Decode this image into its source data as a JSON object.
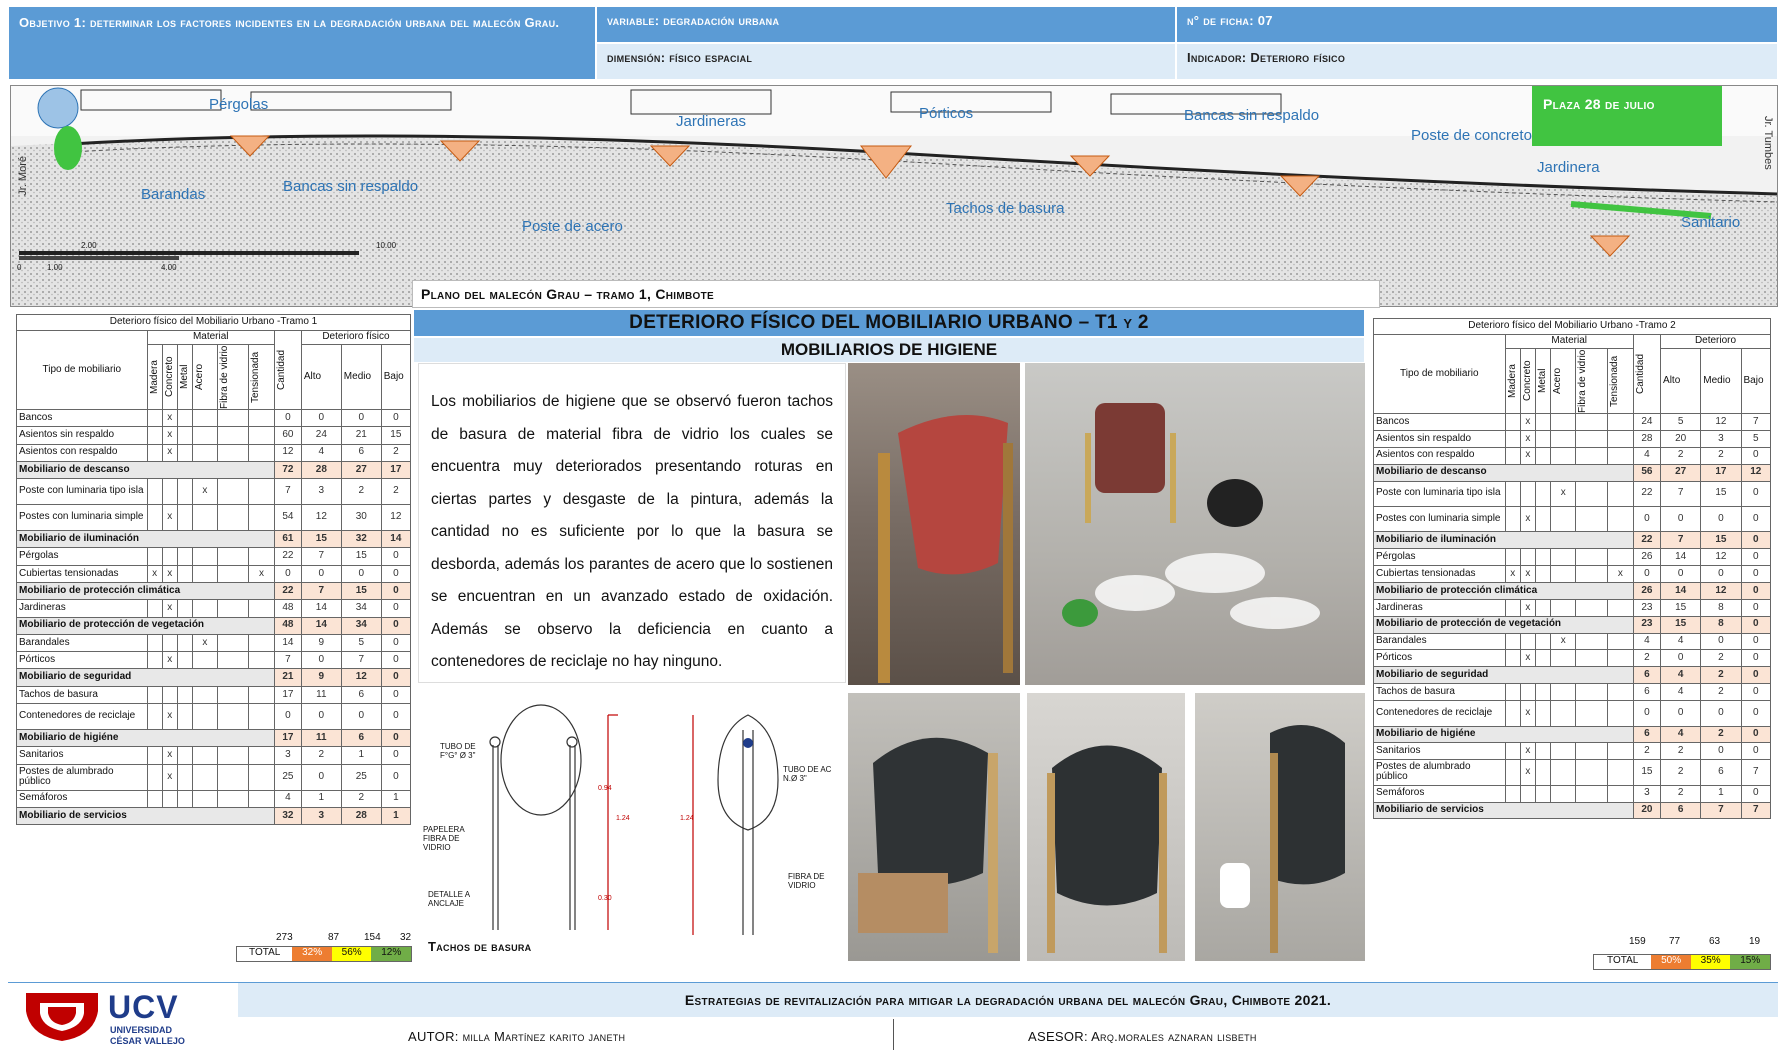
{
  "header": {
    "objetivo": "Objetivo 1: determinar los factores incidentes en la degradación urbana del malecón Grau.",
    "variable": "variable: degradación urbana",
    "ficha": "n° de ficha: 07",
    "dimension": "dimensión: físico espacial",
    "indicador": "Indicador: Deterioro físico"
  },
  "map": {
    "plaza": "Plaza 28 de julio",
    "street_left": "Jr. Moré",
    "street_right": "Jr. Tumbes",
    "labels": [
      "Pérgolas",
      "Barandas",
      "Bancas sin respaldo",
      "Jardineras",
      "Pórticos",
      "Poste de acero",
      "Tachos de basura",
      "Bancas sin respaldo",
      "Poste de concreto",
      "Jardinera",
      "Sanitario"
    ],
    "scale": [
      "2.00",
      "10.00",
      "0",
      "1.00",
      "4.00"
    ]
  },
  "plan_title": "Plano del malecón Grau – tramo 1, Chimbote",
  "main_title": "DETERIORO FÍSICO DEL MOBILIARIO URBANO – T1 y 2",
  "sub_title": "MOBILIARIOS DE HIGIENE",
  "paragraph": "Los mobiliarios de higiene que se observó fueron tachos de basura de material fibra de vidrio los cuales se encuentra muy deteriorados presentando roturas en ciertas partes y desgaste de la pintura, además la cantidad no es suficiente por lo que la basura se desborda, además los parantes de acero que lo sostienen se encuentran en un avanzado estado de oxidación. Además se observo la deficiencia en cuanto a contenedores de reciclaje no hay ninguno.",
  "drawing": {
    "caption": "Tachos de basura",
    "notes": [
      "TUBO DE F°G° Ø 3\"",
      "PAPELERA FIBRA DE VIDRIO",
      "DETALLE A ANCLAJE",
      "TUBO DE AC N.Ø 3\"",
      "FIBRA DE VIDRIO"
    ],
    "dims": [
      "0.94",
      "1.24",
      "1.24",
      "0.30"
    ]
  },
  "table1": {
    "title": "Deterioro físico del Mobiliario Urbano -Tramo 1",
    "h_tipo": "Tipo de mobiliario",
    "h_material": "Material",
    "h_det": "Deterioro físico",
    "mat": [
      "Madera",
      "Concreto",
      "Metal",
      "Acero",
      "Fibra de vidrio",
      "Tensionada"
    ],
    "h_cant": "Cantidad",
    "lv": [
      "Alto",
      "Medio",
      "Bajo"
    ],
    "rows": [
      {
        "n": "Bancos",
        "m": [
          "",
          "x",
          "",
          "",
          "",
          ""
        ],
        "v": [
          "0",
          "0",
          "0",
          "0"
        ]
      },
      {
        "n": "Asientos sin respaldo",
        "m": [
          "",
          "x",
          "",
          "",
          "",
          ""
        ],
        "v": [
          "60",
          "24",
          "21",
          "15"
        ]
      },
      {
        "n": "Asientos con respaldo",
        "m": [
          "",
          "x",
          "",
          "",
          "",
          ""
        ],
        "v": [
          "12",
          "4",
          "6",
          "2"
        ]
      },
      {
        "n": "Mobiliario de descanso",
        "s": 1,
        "v": [
          "72",
          "28",
          "27",
          "17"
        ]
      },
      {
        "n": "Poste con luminaria tipo isla",
        "m": [
          "",
          "",
          "",
          "x",
          "",
          ""
        ],
        "v": [
          "7",
          "3",
          "2",
          "2"
        ]
      },
      {
        "n": "Postes con luminaria simple",
        "m": [
          "",
          "x",
          "",
          "",
          "",
          ""
        ],
        "v": [
          "54",
          "12",
          "30",
          "12"
        ]
      },
      {
        "n": "Mobiliario de iluminación",
        "s": 1,
        "v": [
          "61",
          "15",
          "32",
          "14"
        ]
      },
      {
        "n": "Pérgolas",
        "m": [
          "",
          "",
          "",
          "",
          "",
          ""
        ],
        "v": [
          "22",
          "7",
          "15",
          "0"
        ]
      },
      {
        "n": "Cubiertas tensionadas",
        "m": [
          "x",
          "x",
          "",
          "",
          "",
          "x"
        ],
        "v": [
          "0",
          "0",
          "0",
          "0"
        ]
      },
      {
        "n": "Mobiliario de protección climática",
        "s": 1,
        "v": [
          "22",
          "7",
          "15",
          "0"
        ]
      },
      {
        "n": "Jardineras",
        "m": [
          "",
          "x",
          "",
          "",
          "",
          ""
        ],
        "v": [
          "48",
          "14",
          "34",
          "0"
        ]
      },
      {
        "n": "Mobiliario de protección de vegetación",
        "s": 1,
        "v": [
          "48",
          "14",
          "34",
          "0"
        ]
      },
      {
        "n": "Barandales",
        "m": [
          "",
          "",
          "",
          "x",
          "",
          ""
        ],
        "v": [
          "14",
          "9",
          "5",
          "0"
        ]
      },
      {
        "n": "Pórticos",
        "m": [
          "",
          "x",
          "",
          "",
          "",
          ""
        ],
        "v": [
          "7",
          "0",
          "7",
          "0"
        ]
      },
      {
        "n": "Mobiliario de seguridad",
        "s": 1,
        "v": [
          "21",
          "9",
          "12",
          "0"
        ]
      },
      {
        "n": "Tachos de basura",
        "m": [
          "",
          "",
          "",
          "",
          "",
          ""
        ],
        "v": [
          "17",
          "11",
          "6",
          "0"
        ]
      },
      {
        "n": "Contenedores de reciclaje",
        "m": [
          "",
          "x",
          "",
          "",
          "",
          ""
        ],
        "v": [
          "0",
          "0",
          "0",
          "0"
        ]
      },
      {
        "n": "Mobiliario de higiéne",
        "s": 1,
        "v": [
          "17",
          "11",
          "6",
          "0"
        ]
      },
      {
        "n": "Sanitarios",
        "m": [
          "",
          "x",
          "",
          "",
          "",
          ""
        ],
        "v": [
          "3",
          "2",
          "1",
          "0"
        ]
      },
      {
        "n": "Postes de alumbrado público",
        "m": [
          "",
          "x",
          "",
          "",
          "",
          ""
        ],
        "v": [
          "25",
          "0",
          "25",
          "0"
        ]
      },
      {
        "n": "Semáforos",
        "m": [
          "",
          "",
          "",
          "",
          "",
          ""
        ],
        "v": [
          "4",
          "1",
          "2",
          "1"
        ]
      },
      {
        "n": "Mobiliario de servicios",
        "s": 1,
        "v": [
          "32",
          "3",
          "28",
          "1"
        ]
      }
    ],
    "tot_label": "TOTAL",
    "totals": [
      "273",
      "87",
      "154",
      "32"
    ],
    "pct": [
      "32%",
      "56%",
      "12%"
    ]
  },
  "table2": {
    "title": "Deterioro físico del Mobiliario Urbano -Tramo 2",
    "h_tipo": "Tipo de mobiliario",
    "h_material": "Material",
    "h_det": "Deterioro",
    "mat": [
      "Madera",
      "Concreto",
      "Metal",
      "Acero",
      "Fibra de vidrio",
      "Tensionada"
    ],
    "h_cant": "Cantidad",
    "lv": [
      "Alto",
      "Medio",
      "Bajo"
    ],
    "rows": [
      {
        "n": "Bancos",
        "m": [
          "",
          "x",
          "",
          "",
          "",
          ""
        ],
        "v": [
          "24",
          "5",
          "12",
          "7"
        ]
      },
      {
        "n": "Asientos sin respaldo",
        "m": [
          "",
          "x",
          "",
          "",
          "",
          ""
        ],
        "v": [
          "28",
          "20",
          "3",
          "5"
        ]
      },
      {
        "n": "Asientos con respaldo",
        "m": [
          "",
          "x",
          "",
          "",
          "",
          ""
        ],
        "v": [
          "4",
          "2",
          "2",
          "0"
        ]
      },
      {
        "n": "Mobiliario de descanso",
        "s": 1,
        "v": [
          "56",
          "27",
          "17",
          "12"
        ]
      },
      {
        "n": "Poste con luminaria tipo isla",
        "m": [
          "",
          "",
          "",
          "x",
          "",
          ""
        ],
        "v": [
          "22",
          "7",
          "15",
          "0"
        ]
      },
      {
        "n": "Postes con luminaria simple",
        "m": [
          "",
          "x",
          "",
          "",
          "",
          ""
        ],
        "v": [
          "0",
          "0",
          "0",
          "0"
        ]
      },
      {
        "n": "Mobiliario de iluminación",
        "s": 1,
        "v": [
          "22",
          "7",
          "15",
          "0"
        ]
      },
      {
        "n": "Pérgolas",
        "m": [
          "",
          "",
          "",
          "",
          "",
          ""
        ],
        "v": [
          "26",
          "14",
          "12",
          "0"
        ]
      },
      {
        "n": "Cubiertas tensionadas",
        "m": [
          "x",
          "x",
          "",
          "",
          "",
          "x"
        ],
        "v": [
          "0",
          "0",
          "0",
          "0"
        ]
      },
      {
        "n": "Mobiliario de protección climática",
        "s": 1,
        "v": [
          "26",
          "14",
          "12",
          "0"
        ]
      },
      {
        "n": "Jardineras",
        "m": [
          "",
          "x",
          "",
          "",
          "",
          ""
        ],
        "v": [
          "23",
          "15",
          "8",
          "0"
        ]
      },
      {
        "n": "Mobiliario de protección de vegetación",
        "s": 1,
        "v": [
          "23",
          "15",
          "8",
          "0"
        ]
      },
      {
        "n": "Barandales",
        "m": [
          "",
          "",
          "",
          "x",
          "",
          ""
        ],
        "v": [
          "4",
          "4",
          "0",
          "0"
        ]
      },
      {
        "n": "Pórticos",
        "m": [
          "",
          "x",
          "",
          "",
          "",
          ""
        ],
        "v": [
          "2",
          "0",
          "2",
          "0"
        ]
      },
      {
        "n": "Mobiliario de seguridad",
        "s": 1,
        "v": [
          "6",
          "4",
          "2",
          "0"
        ]
      },
      {
        "n": "Tachos de basura",
        "m": [
          "",
          "",
          "",
          "",
          "",
          ""
        ],
        "v": [
          "6",
          "4",
          "2",
          "0"
        ]
      },
      {
        "n": "Contenedores de reciclaje",
        "m": [
          "",
          "x",
          "",
          "",
          "",
          ""
        ],
        "v": [
          "0",
          "0",
          "0",
          "0"
        ]
      },
      {
        "n": "Mobiliario de higiéne",
        "s": 1,
        "v": [
          "6",
          "4",
          "2",
          "0"
        ]
      },
      {
        "n": "Sanitarios",
        "m": [
          "",
          "x",
          "",
          "",
          "",
          ""
        ],
        "v": [
          "2",
          "2",
          "0",
          "0"
        ]
      },
      {
        "n": "Postes de alumbrado público",
        "m": [
          "",
          "x",
          "",
          "",
          "",
          ""
        ],
        "v": [
          "15",
          "2",
          "6",
          "7"
        ]
      },
      {
        "n": "Semáforos",
        "m": [
          "",
          "",
          "",
          "",
          "",
          ""
        ],
        "v": [
          "3",
          "2",
          "1",
          "0"
        ]
      },
      {
        "n": "Mobiliario de servicios",
        "s": 1,
        "v": [
          "20",
          "6",
          "7",
          "7"
        ]
      }
    ],
    "tot_label": "TOTAL",
    "totals": [
      "159",
      "77",
      "63",
      "19"
    ],
    "pct": [
      "50%",
      "35%",
      "15%"
    ]
  },
  "footer": {
    "brand": "UCV",
    "univ1": "UNIVERSIDAD",
    "univ2": "CÉSAR VALLEJO",
    "strategy": "Estrategias de revitalización para mitigar la degradación urbana del malecón Grau, Chimbote 2021.",
    "autor": "AUTOR: milla Martínez karito janeth",
    "asesor": "ASESOR: Arq.morales aznaran lisbeth"
  },
  "colors": {
    "header_blue": "#5b9bd5",
    "pct_alto": "#ed7d31",
    "pct_medio": "#ffff00",
    "pct_bajo": "#70ad47",
    "summary_row": "#fbe4d5",
    "brand_red": "#c00000"
  }
}
